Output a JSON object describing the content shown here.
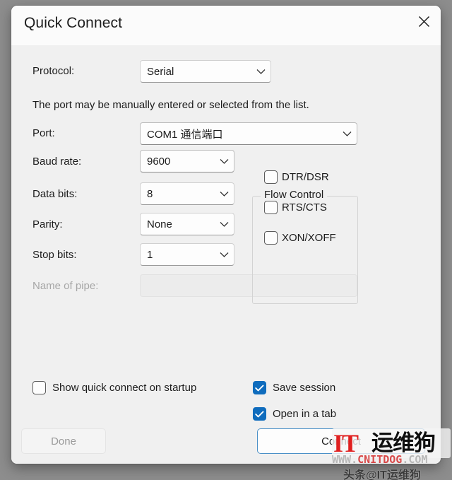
{
  "dialog": {
    "title": "Quick Connect",
    "close_icon": "close-icon"
  },
  "form": {
    "protocol_label": "Protocol:",
    "protocol_value": "Serial",
    "info_text": "The port may be manually entered or selected from the list.",
    "port_label": "Port:",
    "port_value": "COM1 通信端口",
    "baud_label": "Baud rate:",
    "baud_value": "9600",
    "data_bits_label": "Data bits:",
    "data_bits_value": "8",
    "parity_label": "Parity:",
    "parity_value": "None",
    "stop_bits_label": "Stop bits:",
    "stop_bits_value": "1",
    "pipe_label": "Name of pipe:",
    "pipe_value": "",
    "pipe_placeholder": ""
  },
  "flow_control": {
    "legend": "Flow Control",
    "items": [
      {
        "label": "DTR/DSR",
        "checked": false
      },
      {
        "label": "RTS/CTS",
        "checked": false
      },
      {
        "label": "XON/XOFF",
        "checked": false
      }
    ]
  },
  "options": {
    "show_on_startup": {
      "label": "Show quick connect on startup",
      "checked": false
    },
    "save_session": {
      "label": "Save session",
      "checked": true
    },
    "open_in_tab": {
      "label": "Open in a tab",
      "checked": true
    }
  },
  "buttons": {
    "done": "Done",
    "connect": "Connect"
  },
  "watermark": {
    "logo_it": "IT",
    "logo_cn": "运维狗",
    "url_www": "WWW.",
    "url_mid": "CNITDOG",
    "url_end": ".COM",
    "toutiao": "头条@IT运维狗"
  },
  "colors": {
    "accent": "#0f6cbd",
    "focus_border": "#4a90c7",
    "dialog_bg": "#f0f0f0",
    "titlebar_bg": "#fbfbfb",
    "desktop_bg": "#8d8d8d",
    "watermark_red": "#e02020"
  }
}
